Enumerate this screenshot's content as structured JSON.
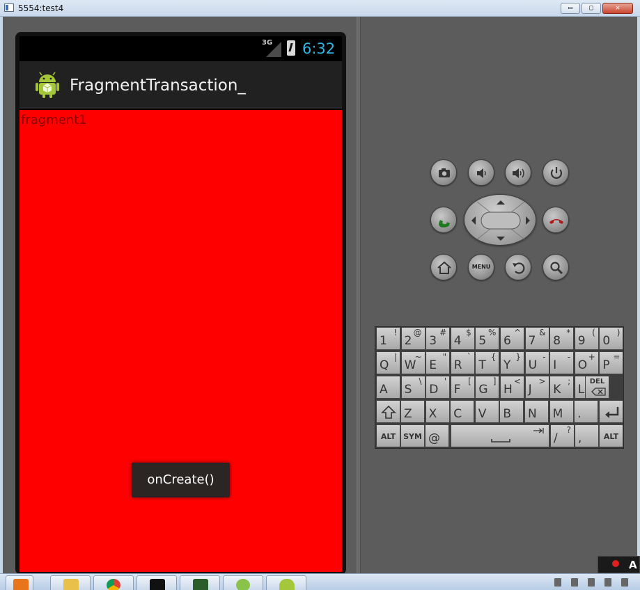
{
  "window": {
    "title": "5554:test4",
    "buttons": {
      "minimize": "▭",
      "restore": "▢",
      "close": "✕"
    }
  },
  "status_bar": {
    "network": "3G",
    "time": "6:32"
  },
  "app": {
    "title": "FragmentTransaction_"
  },
  "content": {
    "fragment_label": "fragment1",
    "background": "#ff0000"
  },
  "toast": {
    "message": "onCreate()"
  },
  "controls": {
    "buttons": [
      "camera-icon",
      "volume-down-icon",
      "volume-up-icon",
      "power-icon",
      "call-icon",
      "end-call-icon",
      "home-icon",
      "menu-button",
      "back-icon",
      "search-icon"
    ],
    "menu_label": "MENU"
  },
  "keyboard": {
    "row1": [
      [
        "1",
        "!"
      ],
      [
        "2",
        "@"
      ],
      [
        "3",
        "#"
      ],
      [
        "4",
        "$"
      ],
      [
        "5",
        "%"
      ],
      [
        "6",
        "^"
      ],
      [
        "7",
        "&"
      ],
      [
        "8",
        "*"
      ],
      [
        "9",
        "("
      ],
      [
        "0",
        ")"
      ]
    ],
    "row2": [
      [
        "Q",
        "|"
      ],
      [
        "W",
        "~"
      ],
      [
        "E",
        "\""
      ],
      [
        "R",
        "`"
      ],
      [
        "T",
        "{"
      ],
      [
        "Y",
        "}"
      ],
      [
        "U",
        "-"
      ],
      [
        "I",
        "-"
      ],
      [
        "O",
        "+"
      ],
      [
        "P",
        "="
      ]
    ],
    "row3": [
      [
        "A",
        ""
      ],
      [
        "S",
        "\\"
      ],
      [
        "D",
        "'"
      ],
      [
        "F",
        "["
      ],
      [
        "G",
        "]"
      ],
      [
        "H",
        "<"
      ],
      [
        "J",
        ">"
      ],
      [
        "K",
        ";"
      ],
      [
        "L",
        ":"
      ]
    ],
    "row4": [
      [
        "Z",
        ""
      ],
      [
        "X",
        ""
      ],
      [
        "C",
        ""
      ],
      [
        "V",
        ""
      ],
      [
        "B",
        ""
      ],
      [
        "N",
        ""
      ],
      [
        "M",
        ""
      ],
      [
        ".",
        ""
      ]
    ],
    "del_label": "DEL",
    "alt_label": "ALT",
    "sym_label": "SYM",
    "at_label": "@",
    "slash": "/",
    "question": "?",
    "comma": ","
  },
  "tray": {
    "ime_text": "A"
  }
}
